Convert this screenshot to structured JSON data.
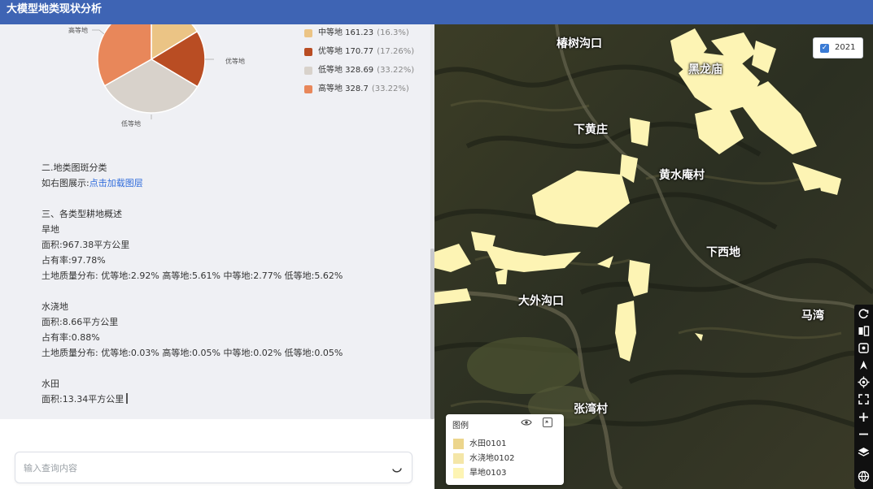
{
  "app": {
    "title": "大模型地类现状分析"
  },
  "pie": {
    "labels": {
      "top": "高等地",
      "right": "优等地",
      "bottom": "低等地"
    },
    "legend": [
      {
        "label": "中等地 161.23",
        "pct": "(16.3%)",
        "color": "#ebc485"
      },
      {
        "label": "优等地 170.77",
        "pct": "(17.26%)",
        "color": "#b94d23"
      },
      {
        "label": "低等地 328.69",
        "pct": "(33.22%)",
        "color": "#d8d2cb"
      },
      {
        "label": "高等地 328.7",
        "pct": "(33.22%)",
        "color": "#e8875a"
      }
    ]
  },
  "chart_data": {
    "type": "pie",
    "categories": [
      "中等地",
      "优等地",
      "低等地",
      "高等地"
    ],
    "values": [
      161.23,
      170.77,
      328.69,
      328.7
    ],
    "percentages": [
      "16.3%",
      "17.26%",
      "33.22%",
      "33.22%"
    ],
    "colors": [
      "#ebc485",
      "#b94d23",
      "#d8d2cb",
      "#e8875a"
    ]
  },
  "report": {
    "section2_title": "二.地类图斑分类",
    "section2_desc": "如右图展示:",
    "section2_link": "点击加载图层",
    "section3_title": "三、各类型耕地概述",
    "dry": {
      "name": "旱地",
      "area": "面积:967.38平方公里",
      "rate": "占有率:97.78%",
      "quality": "土地质量分布: 优等地:2.92% 高等地:5.61% 中等地:2.77% 低等地:5.62%"
    },
    "irrigated": {
      "name": "水浇地",
      "area": "面积:8.66平方公里",
      "rate": "占有率:0.88%",
      "quality": "土地质量分布: 优等地:0.03% 高等地:0.05% 中等地:0.02% 低等地:0.05%"
    },
    "paddy": {
      "name": "水田",
      "area": "面积:13.34平方公里"
    }
  },
  "query": {
    "placeholder": "输入查询内容",
    "value": ""
  },
  "map": {
    "year_label": "2021",
    "year_checked": true,
    "places": [
      "椿树沟口",
      "黑龙庙",
      "下黄庄",
      "黄水庵村",
      "下西地",
      "大外沟口",
      "马湾",
      "张湾村"
    ],
    "legend": {
      "title": "图例",
      "items": [
        {
          "label": "水田0101",
          "color": "#ecd58c"
        },
        {
          "label": "水浇地0102",
          "color": "#f4e6a8"
        },
        {
          "label": "旱地0103",
          "color": "#fdf4b4"
        }
      ]
    },
    "overlay_color": "#fdf4b4",
    "tools": [
      "refresh-icon",
      "split-view-icon",
      "locate-frame-icon",
      "north-arrow-icon",
      "gps-icon",
      "fullscreen-icon",
      "zoom-in-icon",
      "zoom-out-icon",
      "layers-icon",
      "globe-icon"
    ]
  }
}
